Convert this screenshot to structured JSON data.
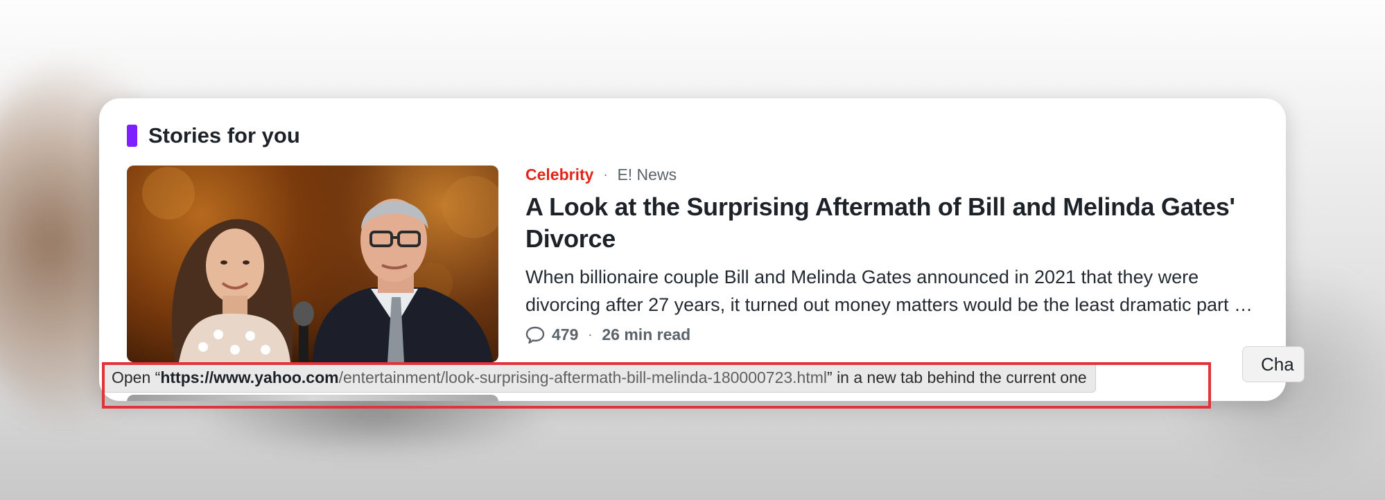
{
  "section": {
    "title": "Stories for you",
    "accent_color": "#7e1fff"
  },
  "story": {
    "category": "Celebrity",
    "category_color": "#e0251b",
    "separator": "·",
    "provider": "E! News",
    "headline": "A Look at the Surprising Aftermath of Bill and Melinda Gates' Divorce",
    "summary": "When billionaire couple Bill and Melinda Gates announced in 2021 that they were divorcing after 27 years, it turned out money matters would be the least dramatic part of the split.",
    "comments_icon": "speech-bubble-icon",
    "comment_count": "479",
    "read_time": "26 min read"
  },
  "side_button": {
    "label": "Cha"
  },
  "status_bar": {
    "prefix": "Open “",
    "domain": "https://www.yahoo.com",
    "path": "/entertainment/look-surprising-aftermath-bill-melinda-180000723.html",
    "suffix": "” in a new tab behind the current one"
  },
  "colors": {
    "highlight": "#e0343a",
    "headline": "#1d2228",
    "meta": "#5b636a"
  }
}
